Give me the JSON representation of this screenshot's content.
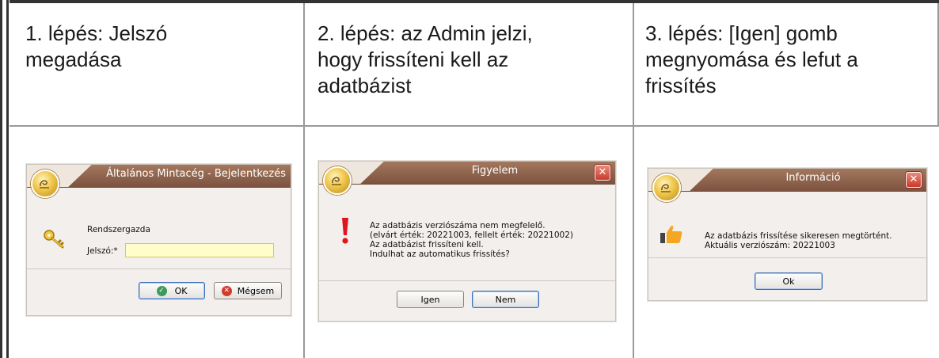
{
  "headers": [
    {
      "lines": [
        "1. lépés: Jelszó",
        "megadása"
      ]
    },
    {
      "lines": [
        "2. lépés: az Admin jelzi,",
        "hogy frissíteni kell az",
        "adatbázist"
      ]
    },
    {
      "lines": [
        "3. lépés: [Igen] gomb",
        "megnyomása és lefut a",
        "frissítés"
      ]
    }
  ],
  "dialog1": {
    "title": "Általános Mintacég - Bejelentkezés",
    "user": "Rendszergazda",
    "password_label": "Jelszó:*",
    "password_value": "",
    "ok_label": "OK",
    "cancel_label": "Mégsem"
  },
  "dialog2": {
    "title": "Figyelem",
    "close_glyph": "✕",
    "message": "Az adatbázis verziószáma nem megfelelő.\n(elvárt érték: 20221003, fellelt érték: 20221002)\nAz adatbázist frissíteni kell.\nIndulhat az automatikus frissítés?",
    "yes_label": "Igen",
    "no_label": "Nem"
  },
  "dialog3": {
    "title": "Információ",
    "close_glyph": "✕",
    "message": "Az adatbázis frissítése sikeresen megtörtént.\nAktuális verziószám: 20221003",
    "ok_label": "Ok"
  },
  "colors": {
    "titlebar": "#8f644d",
    "warning": "#e0141e",
    "thumb": "#f5a623",
    "password_bg": "#fffdc9"
  }
}
